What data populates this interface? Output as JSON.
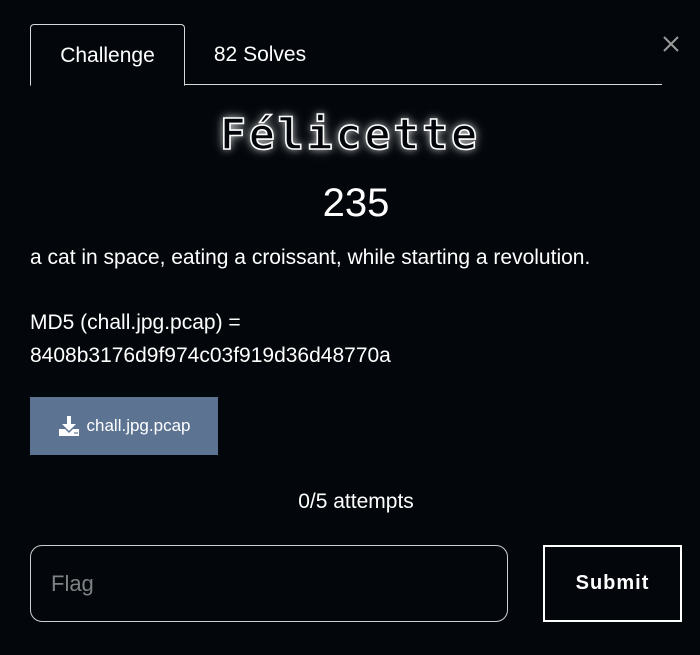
{
  "tabs": [
    {
      "label": "Challenge",
      "active": true
    },
    {
      "label": "82 Solves",
      "active": false
    }
  ],
  "challenge": {
    "name": "Félicette",
    "points": "235",
    "description": "a cat in space, eating a croissant, while starting a revolution.",
    "md5_label": "MD5 (chall.jpg.pcap) =",
    "md5_hash": "8408b3176d9f974c03f919d36d48770a"
  },
  "file": {
    "name": "chall.jpg.pcap",
    "icon": "download-icon"
  },
  "attempts": "0/5 attempts",
  "form": {
    "flag_placeholder": "Flag",
    "flag_value": "",
    "submit_label": "Submit"
  },
  "colors": {
    "background": "#03070b",
    "download_button": "#5c7392",
    "text": "#ffffff"
  }
}
